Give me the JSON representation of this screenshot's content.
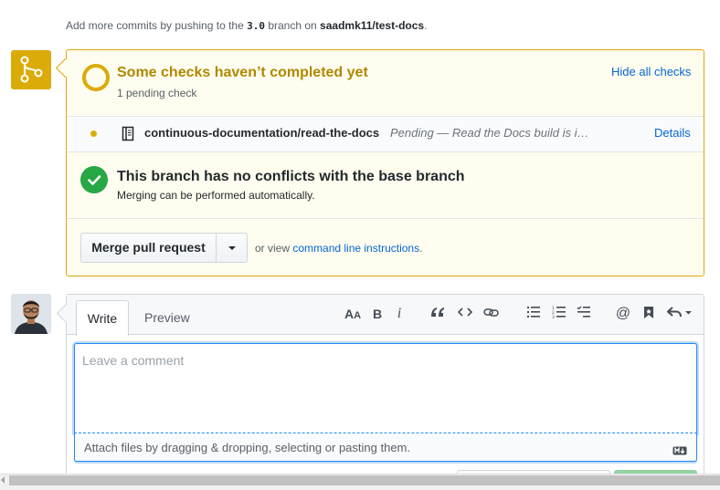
{
  "hint": {
    "prefix": "Add more commits by pushing to the",
    "branch": "3.0",
    "middle": "branch on",
    "repo": "saadmk11/test-docs",
    "suffix": "."
  },
  "checks": {
    "title": "Some checks haven’t completed yet",
    "subtitle": "1 pending check",
    "toggle_label": "Hide all checks",
    "items": [
      {
        "name": "continuous-documentation/read-the-docs",
        "description": "Pending — Read the Docs build is in progress!",
        "link_label": "Details",
        "icon": "book-icon",
        "status_color": "#dbab09"
      }
    ]
  },
  "conflicts": {
    "title": "This branch has no conflicts with the base branch",
    "subtitle": "Merging can be performed automatically."
  },
  "merge": {
    "button_label": "Merge pull request",
    "or_view": "or view",
    "cli_link": "command line instructions",
    "suffix": "."
  },
  "comment": {
    "tabs": [
      "Write",
      "Preview"
    ],
    "active_tab": "Write",
    "placeholder": "Leave a comment",
    "value": "",
    "attach_text": "Attach files by dragging & dropping, selecting or pasting them.",
    "toolbar": [
      {
        "name": "header-text-icon",
        "glyph": "AA"
      },
      {
        "name": "bold-icon",
        "glyph": "B"
      },
      {
        "name": "italic-icon",
        "glyph": "i"
      },
      {
        "name": "quote-icon",
        "glyph": "“"
      },
      {
        "name": "code-icon",
        "glyph": "<>"
      },
      {
        "name": "link-icon",
        "glyph": "⛓"
      },
      {
        "name": "bulleted-list-icon",
        "glyph": "☰"
      },
      {
        "name": "numbered-list-icon",
        "glyph": "☷"
      },
      {
        "name": "task-list-icon",
        "glyph": "☑"
      },
      {
        "name": "mention-icon",
        "glyph": "@"
      },
      {
        "name": "saved-reply-icon",
        "glyph": "🔖"
      },
      {
        "name": "reply-icon",
        "glyph": "↩"
      }
    ]
  },
  "colors": {
    "accent": "#dbab09",
    "success": "#28a745",
    "link": "#0366d6"
  }
}
